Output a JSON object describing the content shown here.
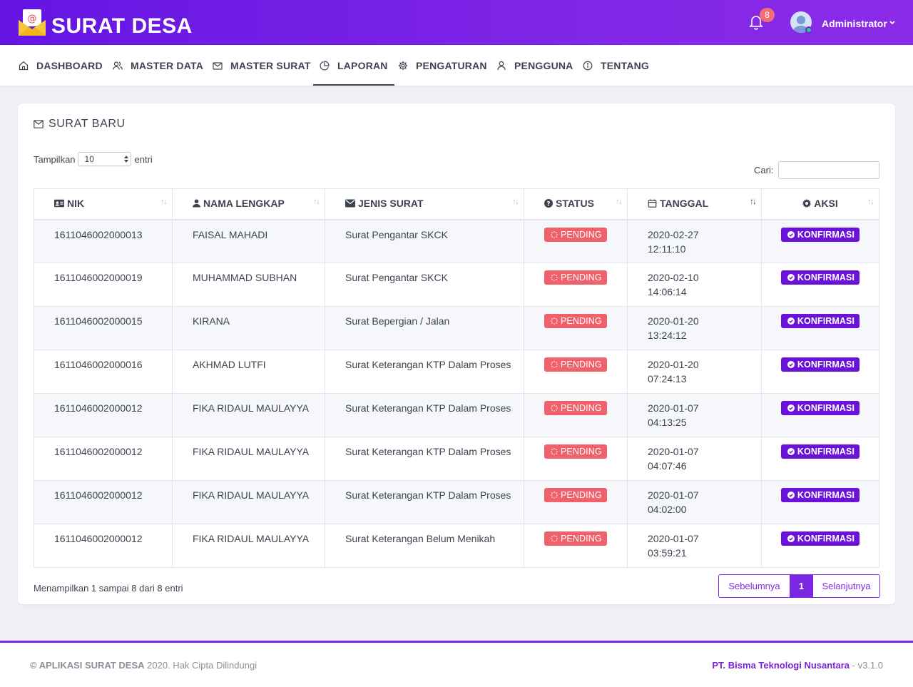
{
  "brand": {
    "title": "SURAT DESA",
    "logo_icon": "envelope-at-icon"
  },
  "header": {
    "notifications_count": "8",
    "user_name": "Administrator"
  },
  "nav": {
    "items": [
      {
        "label": "DASHBOARD",
        "icon": "home-icon"
      },
      {
        "label": "MASTER DATA",
        "icon": "users-icon"
      },
      {
        "label": "MASTER SURAT",
        "icon": "mail-icon"
      },
      {
        "label": "LAPORAN",
        "icon": "pie-chart-icon",
        "active": true
      },
      {
        "label": "PENGATURAN",
        "icon": "gear-icon"
      },
      {
        "label": "PENGGUNA",
        "icon": "user-icon"
      },
      {
        "label": "TENTANG",
        "icon": "info-icon"
      }
    ]
  },
  "card": {
    "title": "SURAT BARU"
  },
  "controls": {
    "show_label": "Tampilkan",
    "show_value": "10",
    "entries_label": "entri",
    "search_label": "Cari:",
    "search_value": ""
  },
  "table": {
    "columns": [
      {
        "label": "NIK",
        "icon": "id-card-icon"
      },
      {
        "label": "NAMA LENGKAP",
        "icon": "user-icon"
      },
      {
        "label": "JENIS SURAT",
        "icon": "envelope-icon"
      },
      {
        "label": "STATUS",
        "icon": "question-circle-icon"
      },
      {
        "label": "TANGGAL",
        "icon": "calendar-icon",
        "sorted": "desc"
      },
      {
        "label": "AKSI",
        "icon": "gear-icon"
      }
    ],
    "status_label": "PENDING",
    "action_label": "KONFIRMASI",
    "rows": [
      {
        "nik": "1611046002000013",
        "nama": "FAISAL MAHADI",
        "jenis": "Surat Pengantar SKCK",
        "tgl_date": "2020-02-27",
        "tgl_time": "12:11:10"
      },
      {
        "nik": "1611046002000019",
        "nama": "MUHAMMAD SUBHAN",
        "jenis": "Surat Pengantar SKCK",
        "tgl_date": "2020-02-10",
        "tgl_time": "14:06:14"
      },
      {
        "nik": "1611046002000015",
        "nama": "KIRANA",
        "jenis": "Surat Bepergian / Jalan",
        "tgl_date": "2020-01-20",
        "tgl_time": "13:24:12"
      },
      {
        "nik": "1611046002000016",
        "nama": "AKHMAD LUTFI",
        "jenis": "Surat Keterangan KTP Dalam Proses",
        "tgl_date": "2020-01-20",
        "tgl_time": "07:24:13"
      },
      {
        "nik": "1611046002000012",
        "nama": "FIKA RIDAUL MAULAYYA",
        "jenis": "Surat Keterangan KTP Dalam Proses",
        "tgl_date": "2020-01-07",
        "tgl_time": "04:13:25"
      },
      {
        "nik": "1611046002000012",
        "nama": "FIKA RIDAUL MAULAYYA",
        "jenis": "Surat Keterangan KTP Dalam Proses",
        "tgl_date": "2020-01-07",
        "tgl_time": "04:07:46"
      },
      {
        "nik": "1611046002000012",
        "nama": "FIKA RIDAUL MAULAYYA",
        "jenis": "Surat Keterangan KTP Dalam Proses",
        "tgl_date": "2020-01-07",
        "tgl_time": "04:02:00"
      },
      {
        "nik": "1611046002000012",
        "nama": "FIKA RIDAUL MAULAYYA",
        "jenis": "Surat Keterangan Belum Menikah",
        "tgl_date": "2020-01-07",
        "tgl_time": "03:59:21"
      }
    ]
  },
  "info": "Menampilkan 1 sampai 8 dari 8 entri",
  "pagination": {
    "prev": "Sebelumnya",
    "current": "1",
    "next": "Selanjutnya"
  },
  "footer": {
    "app_name": "© APLIKASI SURAT DESA",
    "copyright": " 2020. Hak Cipta Dilindungi",
    "company": "PT. Bisma Teknologi Nusantara",
    "version": " - v3.1.0"
  },
  "colors": {
    "primary": "#6a12d9",
    "pending": "#f0616c",
    "badge": "#f06e7a"
  }
}
